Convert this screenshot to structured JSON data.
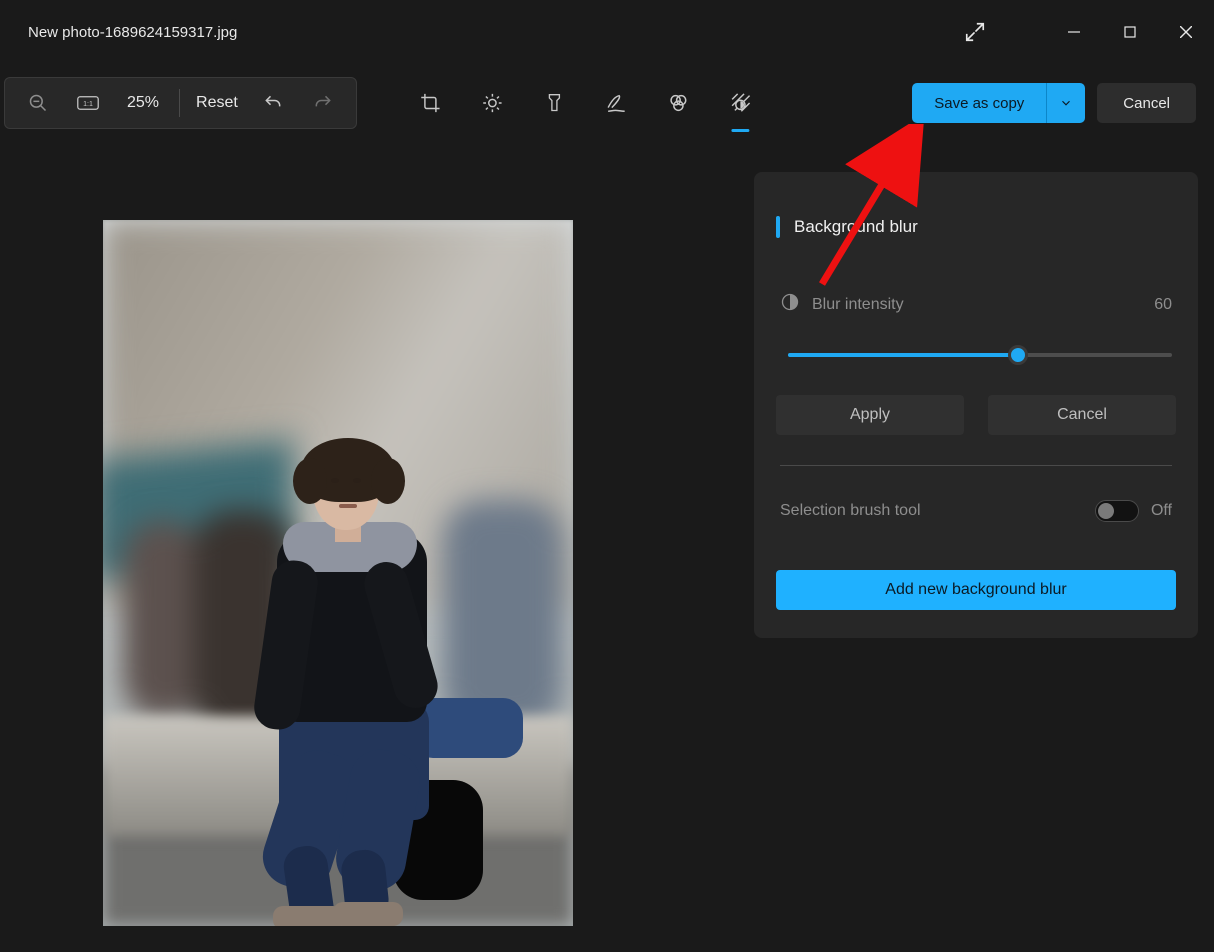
{
  "titlebar": {
    "filename": "New photo-1689624159317.jpg"
  },
  "toolbar": {
    "zoom_percent": "25%",
    "reset_label": "Reset",
    "save_label": "Save as copy",
    "cancel_label": "Cancel"
  },
  "panel": {
    "title": "Background blur",
    "intensity_label": "Blur intensity",
    "intensity_value": "60",
    "intensity_pct": 60,
    "apply_label": "Apply",
    "cancel_label": "Cancel",
    "brush_label": "Selection brush tool",
    "brush_state": "Off",
    "add_label": "Add new background blur"
  }
}
